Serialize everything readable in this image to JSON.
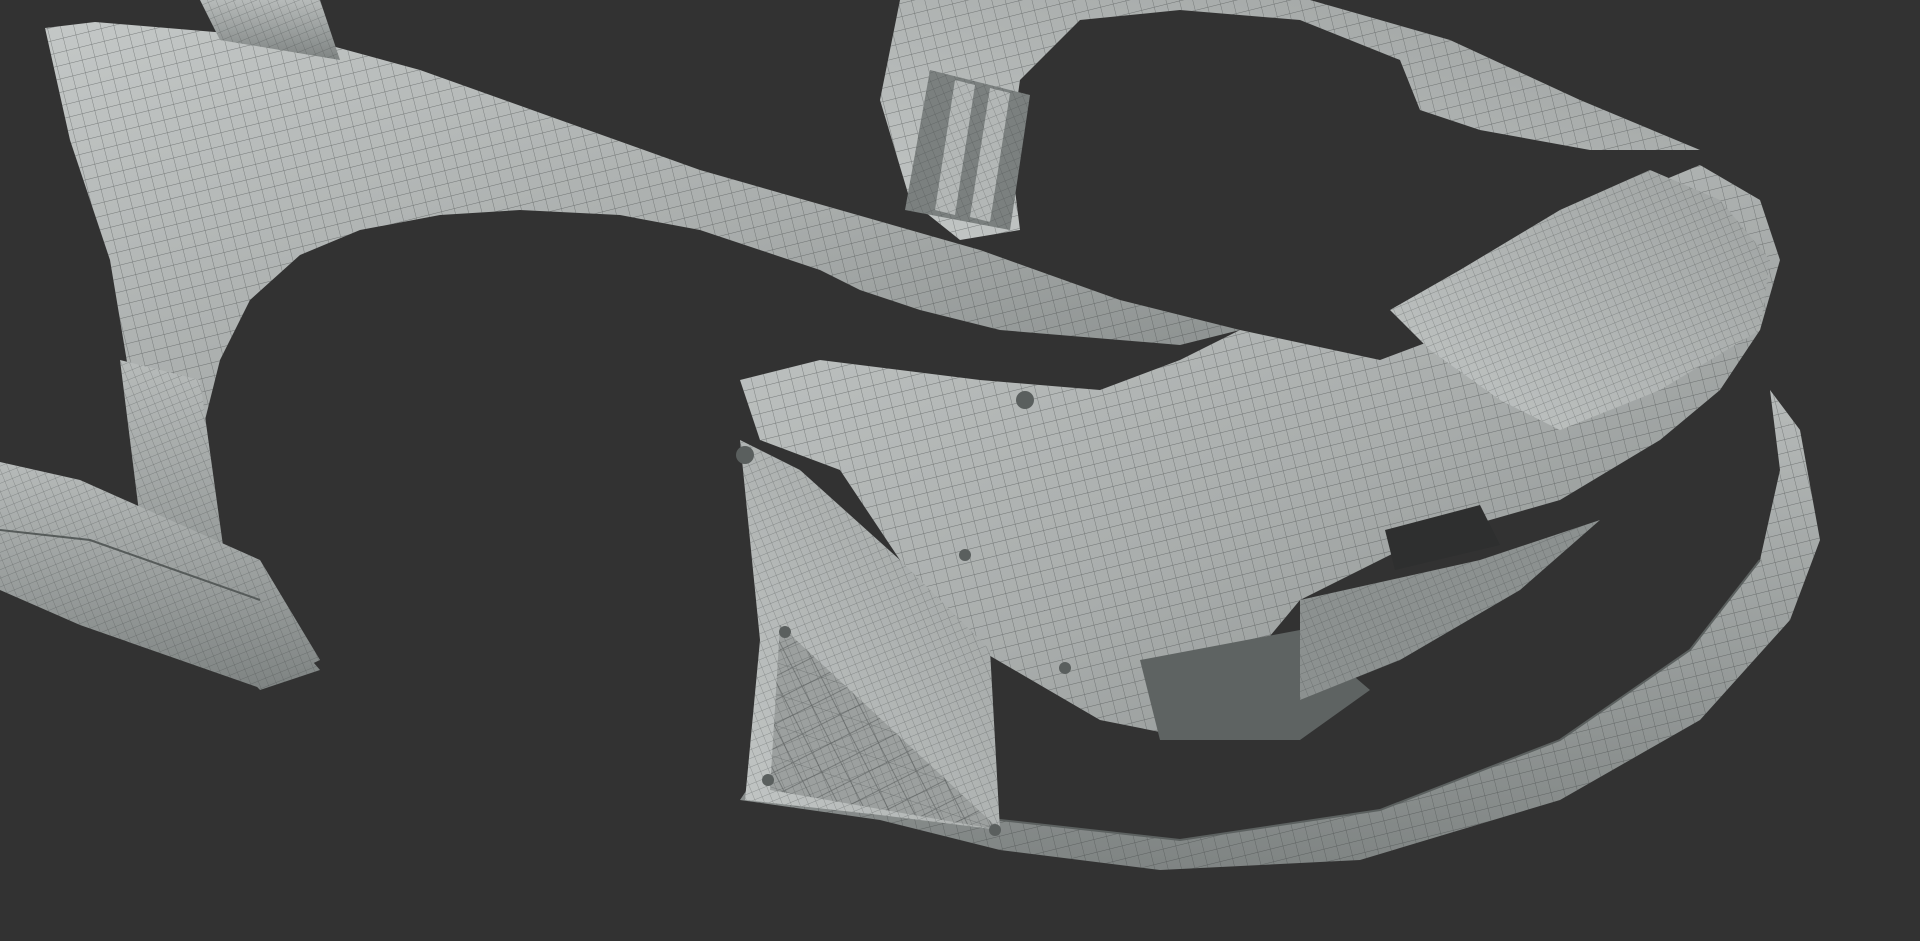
{
  "scene": {
    "subject": "car-front-bodykit-wireframe-render",
    "background_color": "#323232",
    "surface_color": "#a9adac",
    "surface_highlight": "#c7cbca",
    "surface_shadow": "#7d8281",
    "wire_color": "#3f4443",
    "parts": [
      "rear-fender-flare",
      "side-skirt",
      "front-fender",
      "fender-vent",
      "front-bumper",
      "bumper-lip",
      "canard-panel",
      "fender-fasteners"
    ]
  }
}
